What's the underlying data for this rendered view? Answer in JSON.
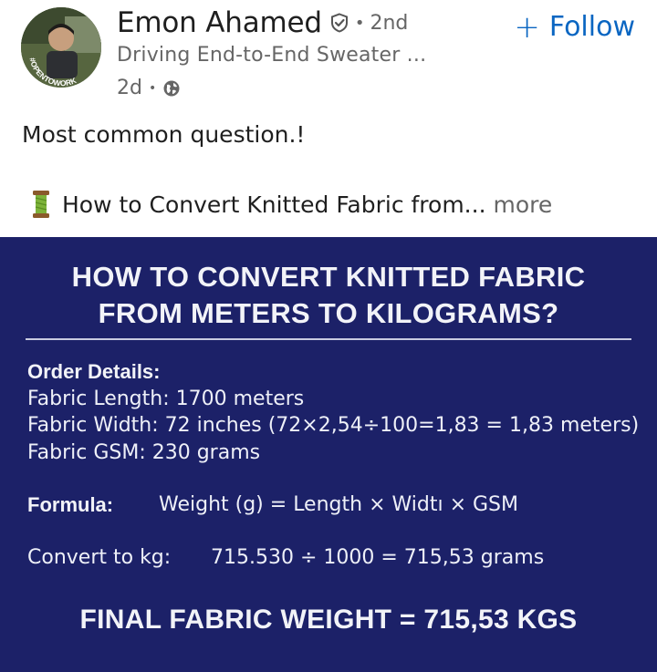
{
  "author": {
    "name": "Emon Ahamed",
    "degree": "2nd",
    "headline": "Driving End-to-End Sweater ...",
    "time": "2d",
    "badge_text": "#OPENTOWORK"
  },
  "actions": {
    "follow_label": "Follow",
    "follow_plus": "+"
  },
  "post": {
    "text": "Most common question.!",
    "preview": "How to Convert Knitted Fabric from...",
    "more_label": "more"
  },
  "card": {
    "title_line1": "HOW TO CONVERT KNITTED FABRIC",
    "title_line2": "FROM METERS TO KILOGRAMS?",
    "order_heading": "Order Details:",
    "fabric_length": "Fabric Length: 1700 meters",
    "fabric_width": "Fabric Width: 72 inches (72×2,54÷100=1,83 = 1,83 meters)",
    "fabric_gsm": "Fabric GSM: 230 grams",
    "formula_label": "Formula:",
    "formula": "Weight (g) = Length × Widtı × GSM",
    "convert_label": "Convert to kg:",
    "convert": "715.530 ÷ 1000 = 715,53 grams",
    "final": "FINAL FABRIC WEIGHT = 715,53 KGS"
  },
  "colors": {
    "card_bg": "#1c2168",
    "follow_blue": "#0a66c2",
    "open_to_work_green": "#2f7d32"
  },
  "icons": {
    "verify": "verified-shield-icon",
    "visibility": "globe-icon",
    "emoji": "thread-spool-icon"
  }
}
